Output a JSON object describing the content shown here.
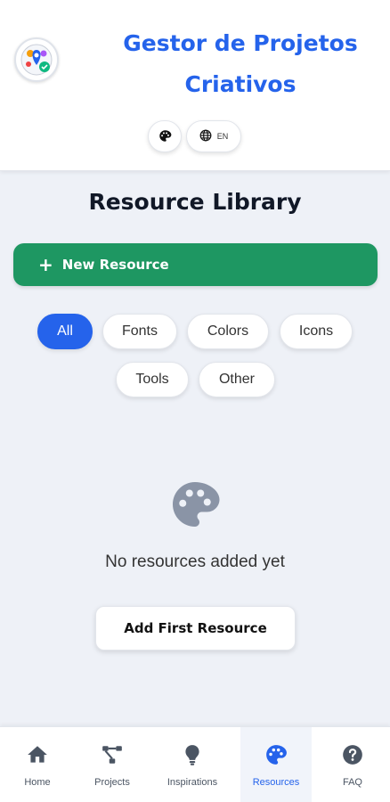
{
  "header": {
    "title_line1": "Gestor de Projetos",
    "title_line2": "Criativos",
    "lang_label": "EN",
    "logo_icon": "app-logo-icon",
    "theme_icon": "palette-icon",
    "lang_icon": "globe-icon"
  },
  "main": {
    "page_title": "Resource Library",
    "new_button_plus": "+",
    "new_button_label": "New Resource",
    "filters": [
      {
        "label": "All",
        "active": true
      },
      {
        "label": "Fonts",
        "active": false
      },
      {
        "label": "Colors",
        "active": false
      },
      {
        "label": "Icons",
        "active": false
      },
      {
        "label": "Tools",
        "active": false
      },
      {
        "label": "Other",
        "active": false
      }
    ],
    "empty_icon": "palette-icon",
    "empty_text": "No resources added yet",
    "add_first_label": "Add First Resource"
  },
  "nav": {
    "items": [
      {
        "label": "Home",
        "icon": "home-icon",
        "active": false
      },
      {
        "label": "Projects",
        "icon": "project-diagram-icon",
        "active": false
      },
      {
        "label": "Inspirations",
        "icon": "lightbulb-icon",
        "active": false
      },
      {
        "label": "Resources",
        "icon": "palette-icon",
        "active": true
      },
      {
        "label": "FAQ",
        "icon": "question-circle-icon",
        "active": false
      }
    ]
  },
  "colors": {
    "primary": "#2563eb",
    "success": "#1e9762",
    "nav_icon": "#4b5563",
    "empty_icon": "#8a94a6"
  }
}
